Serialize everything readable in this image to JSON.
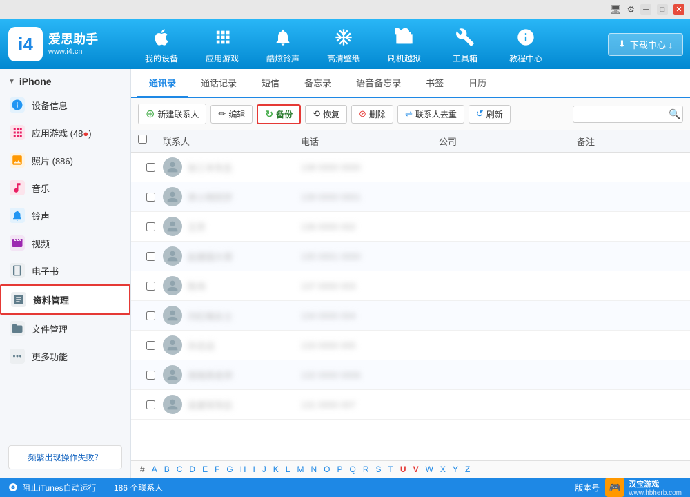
{
  "titlebar": {
    "buttons": [
      "monitor-icon",
      "settings-icon",
      "minimize-icon",
      "maximize-icon",
      "close-icon"
    ]
  },
  "header": {
    "logo": {
      "main": "爱思助手",
      "sub": "www.i4.cn"
    },
    "nav": [
      {
        "label": "我的设备",
        "icon": "🍎",
        "id": "my-device"
      },
      {
        "label": "应用游戏",
        "icon": "🅰",
        "id": "apps"
      },
      {
        "label": "酷炫铃声",
        "icon": "🔔",
        "id": "ringtone"
      },
      {
        "label": "高清壁纸",
        "icon": "❄",
        "id": "wallpaper"
      },
      {
        "label": "刷机越狱",
        "icon": "📦",
        "id": "jailbreak"
      },
      {
        "label": "工具箱",
        "icon": "⚙",
        "id": "tools"
      },
      {
        "label": "教程中心",
        "icon": "ℹ",
        "id": "tutorial"
      }
    ],
    "download_btn": "下载中心 ↓"
  },
  "sidebar": {
    "device_label": "iPhone",
    "items": [
      {
        "id": "device-info",
        "label": "设备信息",
        "icon": "ℹ",
        "icon_color": "#2196f3"
      },
      {
        "id": "apps-games",
        "label": "应用游戏 (48)",
        "icon": "🅰",
        "icon_color": "#e91e63",
        "badge": "48"
      },
      {
        "id": "photos",
        "label": "照片 (886)",
        "icon": "🖼",
        "icon_color": "#ff9800"
      },
      {
        "id": "music",
        "label": "音乐",
        "icon": "🎵",
        "icon_color": "#e91e63"
      },
      {
        "id": "ringtones",
        "label": "铃声",
        "icon": "🔔",
        "icon_color": "#2196f3"
      },
      {
        "id": "video",
        "label": "视频",
        "icon": "🎬",
        "icon_color": "#9c27b0"
      },
      {
        "id": "ebook",
        "label": "电子书",
        "icon": "📖",
        "icon_color": "#607d8b"
      },
      {
        "id": "data-mgmt",
        "label": "资料管理",
        "icon": "📋",
        "icon_color": "#607d8b",
        "active": true
      },
      {
        "id": "file-mgmt",
        "label": "文件管理",
        "icon": "📁",
        "icon_color": "#607d8b"
      },
      {
        "id": "more",
        "label": "更多功能",
        "icon": "⚙",
        "icon_color": "#607d8b"
      }
    ],
    "trouble_btn": "频繁出现操作失败？"
  },
  "tabs": [
    "通讯录",
    "通话记录",
    "短信",
    "备忘录",
    "语音备忘录",
    "书签",
    "日历"
  ],
  "active_tab": "通讯录",
  "toolbar": {
    "new_contact": "新建联系人",
    "edit": "编辑",
    "backup": "备份",
    "restore": "恢复",
    "delete": "删除",
    "merge": "联系人去重",
    "refresh": "刷新",
    "search_placeholder": ""
  },
  "table": {
    "columns": [
      "",
      "联系人",
      "电话",
      "公司",
      "备注"
    ],
    "rows": [
      {
        "name": "••••••",
        "phone": "••••••••••",
        "company": "",
        "note": ""
      },
      {
        "name": "••••••••",
        "phone": "••••••••••",
        "company": "",
        "note": ""
      },
      {
        "name": "•••",
        "phone": "•••••••",
        "company": "",
        "note": ""
      },
      {
        "name": "••••••",
        "phone": "••••••••••",
        "company": "",
        "note": ""
      },
      {
        "name": "•••",
        "phone": "•••••••••",
        "company": "",
        "note": ""
      },
      {
        "name": "••••••",
        "phone": "•••••••••",
        "company": "",
        "note": ""
      },
      {
        "name": "•••••",
        "phone": "•••••••••",
        "company": "",
        "note": ""
      },
      {
        "name": "••••••••",
        "phone": "••••••••••",
        "company": "",
        "note": ""
      },
      {
        "name": "•••••••",
        "phone": "•••••••••",
        "company": "",
        "note": ""
      }
    ]
  },
  "alphabet": [
    "#",
    "A",
    "B",
    "C",
    "D",
    "E",
    "F",
    "G",
    "H",
    "I",
    "J",
    "K",
    "L",
    "M",
    "N",
    "O",
    "P",
    "Q",
    "R",
    "S",
    "T",
    "U",
    "V",
    "W",
    "X",
    "Y",
    "Z"
  ],
  "active_letters": [
    "U",
    "V"
  ],
  "status": {
    "left": "阻止iTunes自动运行",
    "count": "186 个联系人",
    "version": "版本号",
    "watermark": "汉宝游戏",
    "watermark_url": "www.hbherb.com"
  },
  "colors": {
    "primary": "#1e88e5",
    "accent": "#e53935",
    "green": "#4caf50",
    "sidebar_bg": "#f5f7fa"
  }
}
